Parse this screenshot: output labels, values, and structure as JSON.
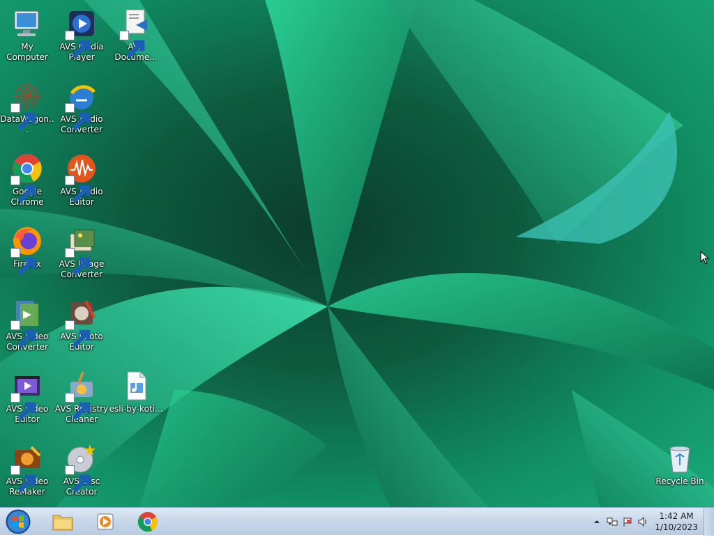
{
  "desktop": {
    "icons": [
      {
        "label": "My Computer",
        "icon": "computer-icon"
      },
      {
        "label": "AVS Media Player",
        "icon": "avs-media-player-icon"
      },
      {
        "label": "AVS Docume...",
        "icon": "avs-document-converter-icon"
      },
      {
        "label": "DataWagon...",
        "icon": "datawagon-icon"
      },
      {
        "label": "AVS Audio Converter",
        "icon": "avs-audio-converter-icon"
      },
      {
        "label": "Google Chrome",
        "icon": "chrome-icon"
      },
      {
        "label": "AVS Audio Editor",
        "icon": "avs-audio-editor-icon"
      },
      {
        "label": "Firefox",
        "icon": "firefox-icon"
      },
      {
        "label": "AVS Image Converter",
        "icon": "avs-image-converter-icon"
      },
      {
        "label": "AVS Video Converter",
        "icon": "avs-video-converter-icon"
      },
      {
        "label": "AVS Photo Editor",
        "icon": "avs-photo-editor-icon"
      },
      {
        "label": "AVS Video Editor",
        "icon": "avs-video-editor-icon"
      },
      {
        "label": "AVS Registry Cleaner",
        "icon": "avs-registry-cleaner-icon"
      },
      {
        "label": "esli-by-koti...",
        "icon": "audio-file-icon"
      },
      {
        "label": "AVS Video ReMaker",
        "icon": "avs-video-remaker-icon"
      },
      {
        "label": "AVS Disc Creator",
        "icon": "avs-disc-creator-icon"
      },
      {
        "label": "Recycle Bin",
        "icon": "recycle-bin-icon"
      }
    ]
  },
  "taskbar": {
    "start_icon": "windows-start-icon",
    "pinned": [
      {
        "name": "Windows Explorer",
        "icon": "folder-icon"
      },
      {
        "name": "Windows Media Player",
        "icon": "media-player-icon"
      },
      {
        "name": "Google Chrome",
        "icon": "chrome-icon"
      }
    ],
    "tray": {
      "icons": [
        "show-hidden-icons-arrow",
        "network-icon",
        "action-center-flag-icon",
        "volume-icon"
      ],
      "time": "1:42 AM",
      "date": "1/10/2023"
    }
  },
  "colors": {
    "wallpaper_dark": "#0b3d2c",
    "wallpaper_light": "#1aa97a",
    "taskbar": "#c9d8ea"
  }
}
